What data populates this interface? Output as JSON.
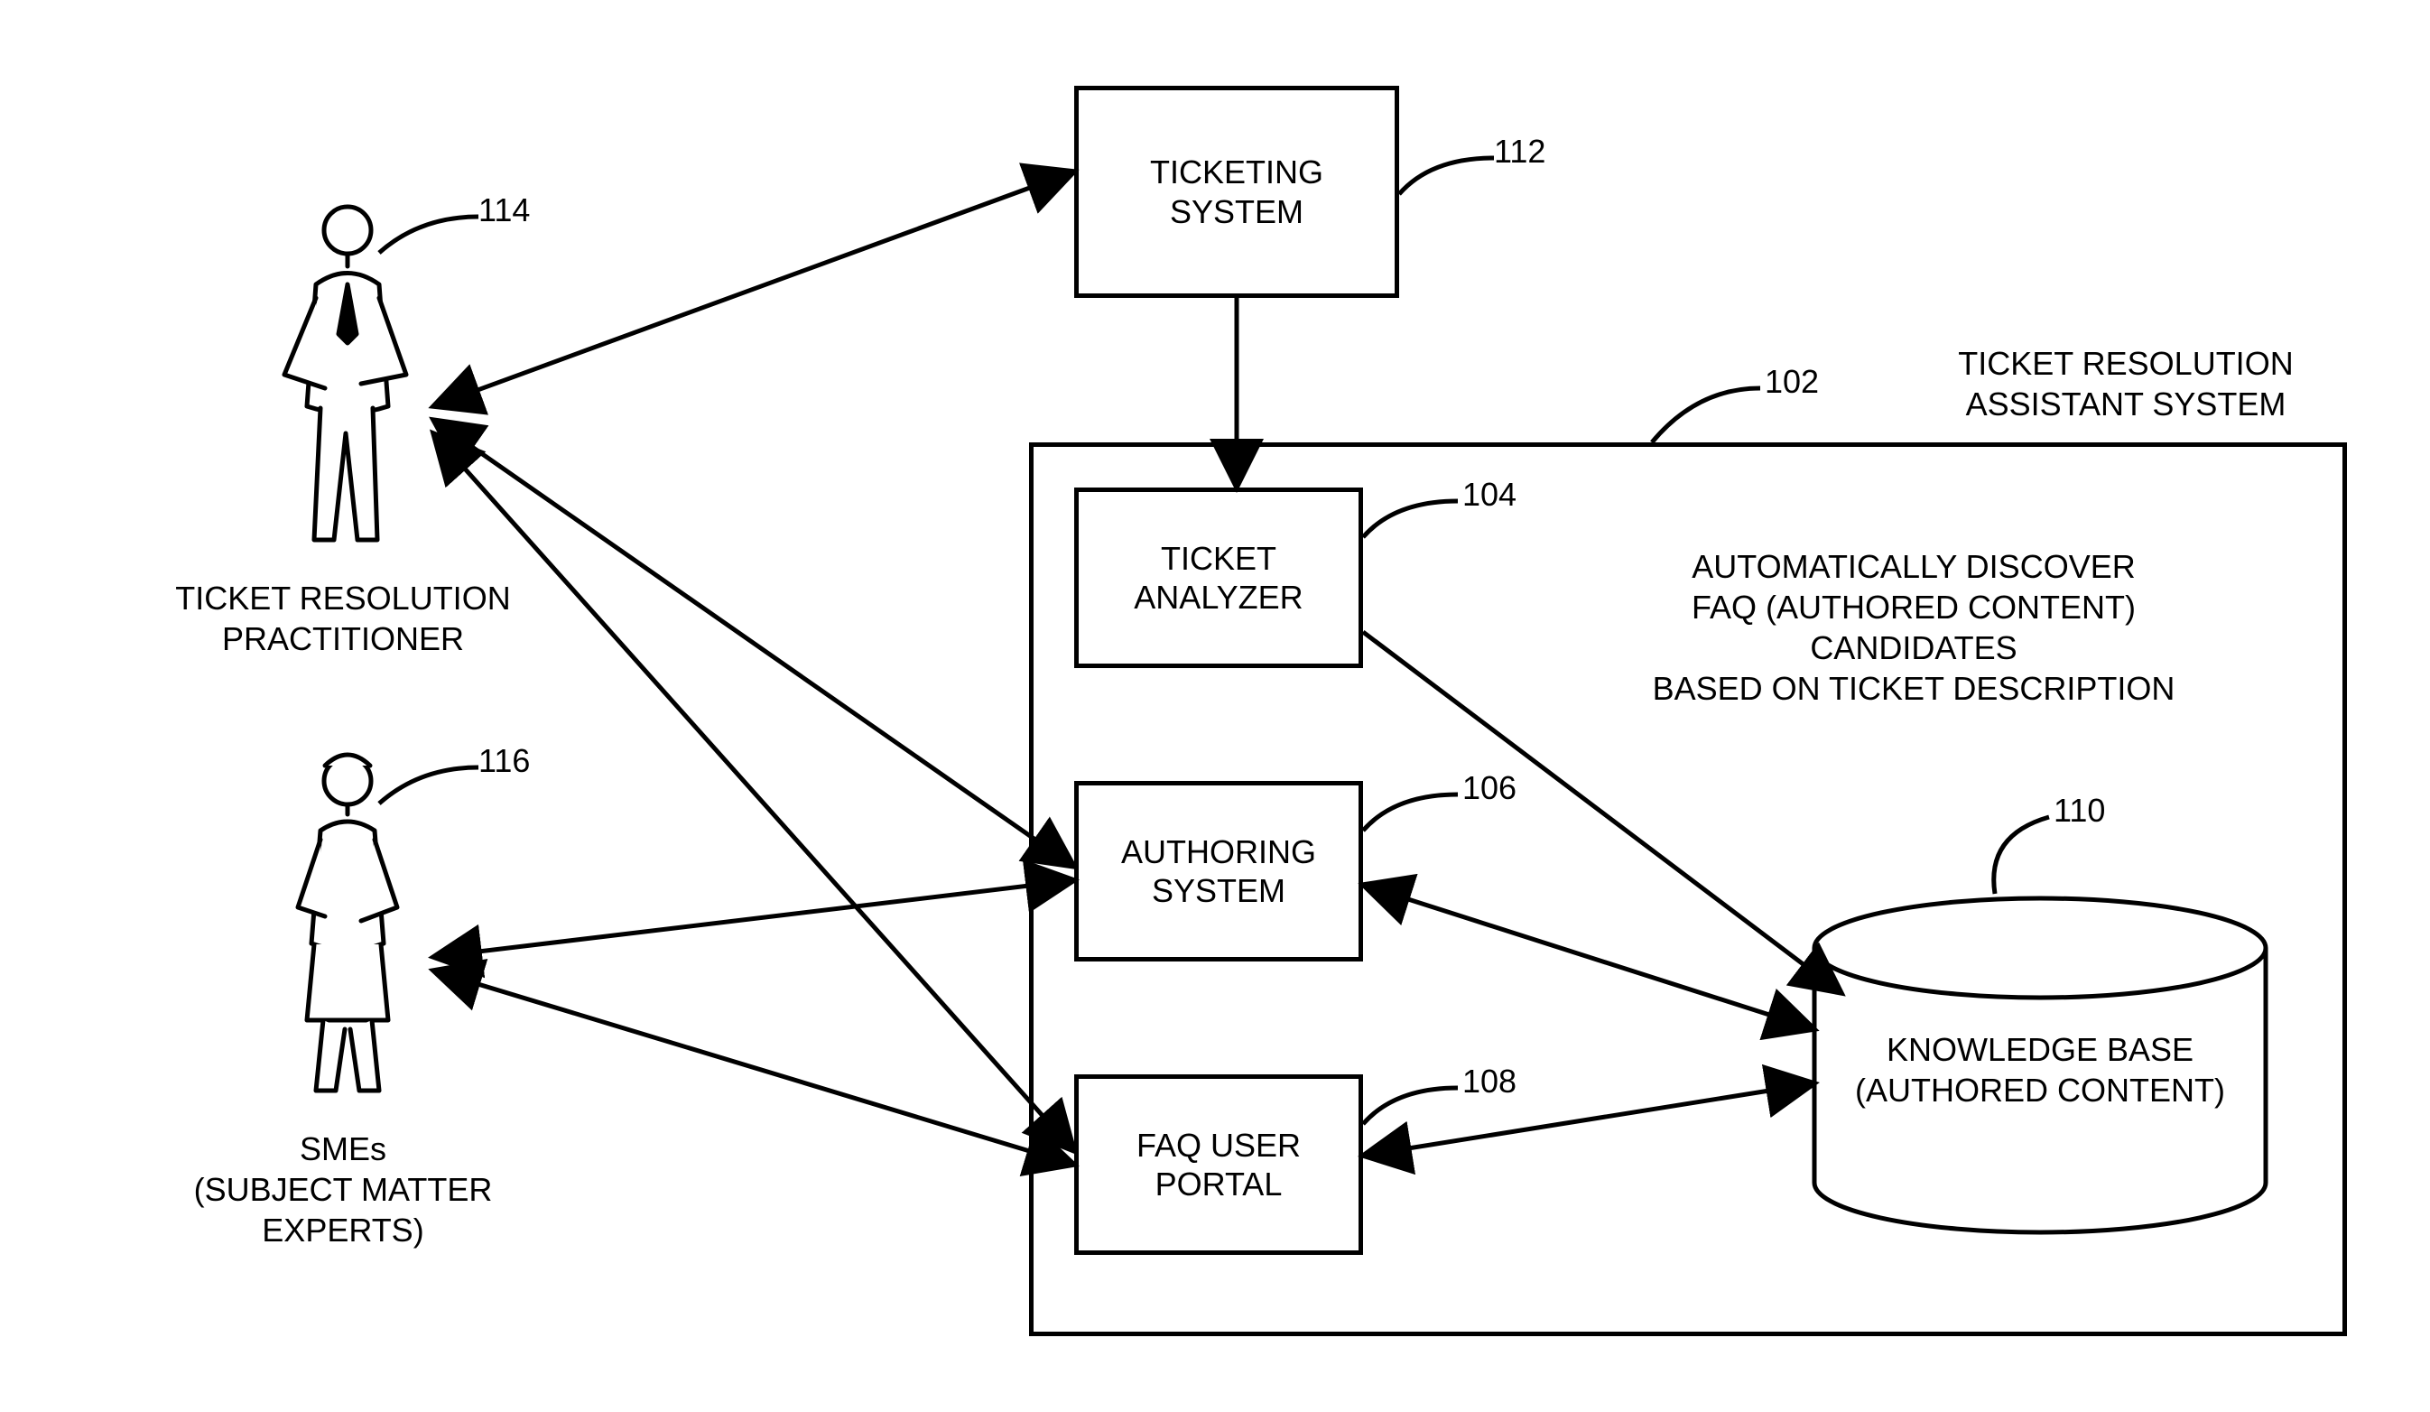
{
  "nodes": {
    "ticketing_system": {
      "label": "TICKETING\nSYSTEM",
      "ref": "112"
    },
    "ticket_analyzer": {
      "label": "TICKET\nANALYZER",
      "ref": "104"
    },
    "authoring_system": {
      "label": "AUTHORING\nSYSTEM",
      "ref": "106"
    },
    "faq_user_portal": {
      "label": "FAQ USER\nPORTAL",
      "ref": "108"
    },
    "knowledge_base": {
      "label": "KNOWLEDGE BASE\n(AUTHORED CONTENT)",
      "ref": "110"
    },
    "assistant_system": {
      "label": "TICKET RESOLUTION\nASSISTANT SYSTEM",
      "ref": "102"
    },
    "assistant_note": {
      "label": "AUTOMATICALLY DISCOVER\nFAQ (AUTHORED CONTENT) CANDIDATES\nBASED ON TICKET DESCRIPTION"
    }
  },
  "actors": {
    "practitioner": {
      "label": "TICKET RESOLUTION\nPRACTITIONER",
      "ref": "114"
    },
    "smes": {
      "label": "SMEs\n(SUBJECT MATTER EXPERTS)",
      "ref": "116"
    }
  },
  "edges": [
    {
      "from": "practitioner",
      "to": "ticketing_system",
      "bidir": true
    },
    {
      "from": "practitioner",
      "to": "authoring_system",
      "bidir": true
    },
    {
      "from": "practitioner",
      "to": "faq_user_portal",
      "bidir": true
    },
    {
      "from": "smes",
      "to": "authoring_system",
      "bidir": true
    },
    {
      "from": "smes",
      "to": "faq_user_portal",
      "bidir": true
    },
    {
      "from": "ticketing_system",
      "to": "ticket_analyzer",
      "bidir": false
    },
    {
      "from": "ticket_analyzer",
      "to": "knowledge_base",
      "bidir": false
    },
    {
      "from": "authoring_system",
      "to": "knowledge_base",
      "bidir": true
    },
    {
      "from": "faq_user_portal",
      "to": "knowledge_base",
      "bidir": true
    }
  ]
}
